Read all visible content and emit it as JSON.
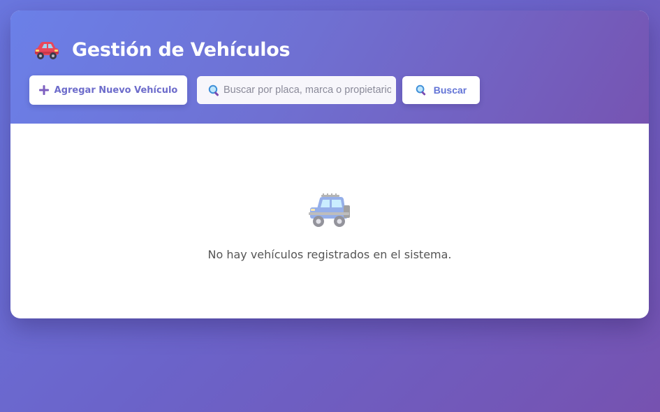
{
  "header": {
    "title": "Gestión de Vehículos",
    "title_icon": "red-car-icon",
    "add_button_label": "Agregar Nuevo Vehículo",
    "add_button_icon": "plus-icon",
    "search": {
      "placeholder": "Buscar por placa, marca o propietario...",
      "value": "",
      "icon": "magnifier-icon"
    },
    "search_button_label": "Buscar",
    "search_button_icon": "magnifier-icon"
  },
  "empty_state": {
    "icon": "jeep-icon",
    "message": "No hay vehículos registrados en el sistema."
  },
  "colors": {
    "accent": "#6d6ccb",
    "search_button_text": "#6374d6",
    "header_gradient_start": "#6b80e8",
    "header_gradient_end": "#7654b2",
    "empty_text": "#555555"
  }
}
